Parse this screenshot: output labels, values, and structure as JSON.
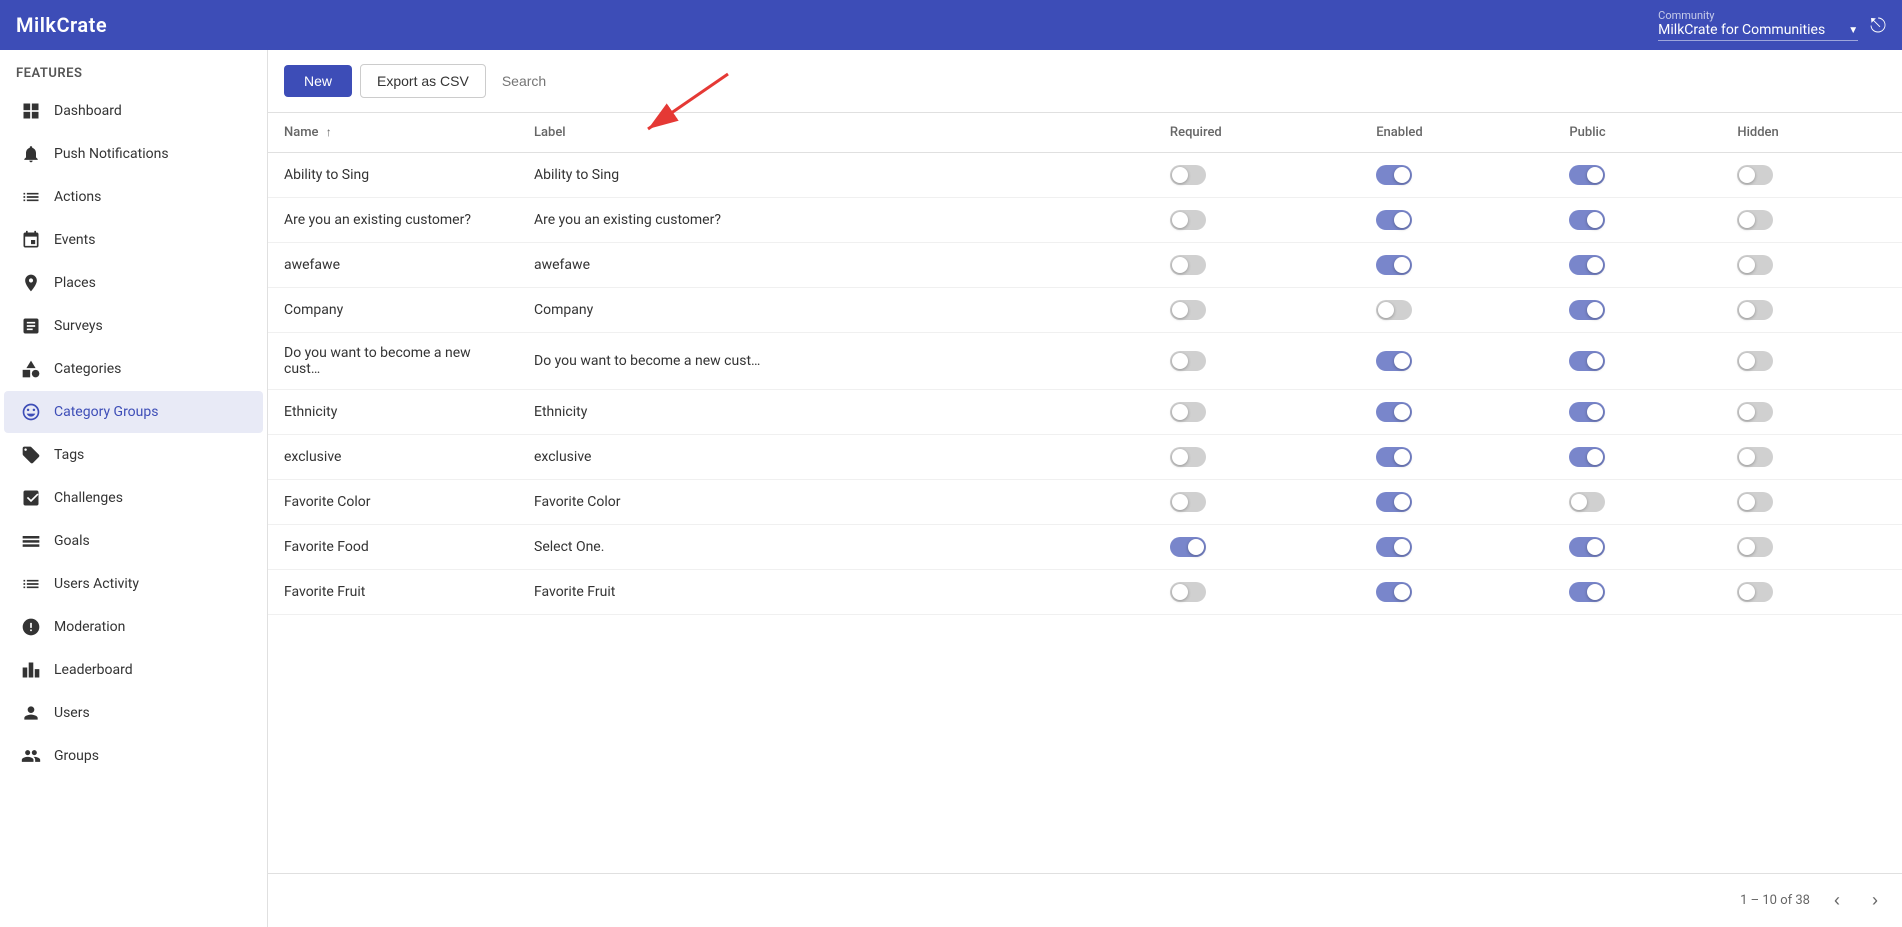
{
  "header": {
    "logo": "MilkCrate",
    "community_label": "Community",
    "community_name": "MilkCrate for Communities",
    "logout_icon": "logout-icon"
  },
  "sidebar": {
    "section_title": "Features",
    "items": [
      {
        "id": "dashboard",
        "label": "Dashboard",
        "icon": "dashboard-icon"
      },
      {
        "id": "push-notifications",
        "label": "Push Notifications",
        "icon": "bell-icon"
      },
      {
        "id": "actions",
        "label": "Actions",
        "icon": "list-icon"
      },
      {
        "id": "events",
        "label": "Events",
        "icon": "calendar-icon"
      },
      {
        "id": "places",
        "label": "Places",
        "icon": "pin-icon"
      },
      {
        "id": "surveys",
        "label": "Surveys",
        "icon": "survey-icon"
      },
      {
        "id": "categories",
        "label": "Categories",
        "icon": "categories-icon"
      },
      {
        "id": "category-groups",
        "label": "Category Groups",
        "icon": "category-groups-icon"
      },
      {
        "id": "tags",
        "label": "Tags",
        "icon": "tags-icon"
      },
      {
        "id": "challenges",
        "label": "Challenges",
        "icon": "challenges-icon"
      },
      {
        "id": "goals",
        "label": "Goals",
        "icon": "goals-icon"
      },
      {
        "id": "users-activity",
        "label": "Users Activity",
        "icon": "users-activity-icon"
      },
      {
        "id": "moderation",
        "label": "Moderation",
        "icon": "moderation-icon"
      },
      {
        "id": "leaderboard",
        "label": "Leaderboard",
        "icon": "leaderboard-icon"
      },
      {
        "id": "users",
        "label": "Users",
        "icon": "users-icon"
      },
      {
        "id": "groups",
        "label": "Groups",
        "icon": "groups-icon"
      }
    ]
  },
  "toolbar": {
    "new_label": "New",
    "export_label": "Export as CSV",
    "search_placeholder": "Search"
  },
  "table": {
    "columns": [
      {
        "id": "name",
        "label": "Name",
        "sort": "asc"
      },
      {
        "id": "label",
        "label": "Label"
      },
      {
        "id": "required",
        "label": "Required"
      },
      {
        "id": "enabled",
        "label": "Enabled"
      },
      {
        "id": "public",
        "label": "Public"
      },
      {
        "id": "hidden",
        "label": "Hidden"
      }
    ],
    "rows": [
      {
        "name": "Ability to Sing",
        "label": "Ability to Sing",
        "required": "off",
        "enabled": "on",
        "public": "on",
        "hidden": "off"
      },
      {
        "name": "Are you an existing customer?",
        "label": "Are you an existing customer?",
        "required": "off",
        "enabled": "on",
        "public": "on",
        "hidden": "off"
      },
      {
        "name": "awefawe",
        "label": "awefawe",
        "required": "off",
        "enabled": "on",
        "public": "on",
        "hidden": "off"
      },
      {
        "name": "Company",
        "label": "Company",
        "required": "off",
        "enabled": "off",
        "public": "on",
        "hidden": "off"
      },
      {
        "name": "Do you want to become a new cust…",
        "label": "Do you want to become a new cust…",
        "required": "off",
        "enabled": "on",
        "public": "on",
        "hidden": "off"
      },
      {
        "name": "Ethnicity",
        "label": "Ethnicity",
        "required": "off",
        "enabled": "on",
        "public": "on",
        "hidden": "off"
      },
      {
        "name": "exclusive",
        "label": "exclusive",
        "required": "off",
        "enabled": "on",
        "public": "on",
        "hidden": "off"
      },
      {
        "name": "Favorite Color",
        "label": "Favorite Color",
        "required": "off",
        "enabled": "on",
        "public": "off",
        "hidden": "off"
      },
      {
        "name": "Favorite Food",
        "label": "Select One.",
        "required": "on",
        "enabled": "on",
        "public": "on",
        "hidden": "off"
      },
      {
        "name": "Favorite Fruit",
        "label": "Favorite Fruit",
        "required": "off",
        "enabled": "on",
        "public": "on",
        "hidden": "off"
      }
    ]
  },
  "pagination": {
    "info": "1 – 10 of 38"
  }
}
